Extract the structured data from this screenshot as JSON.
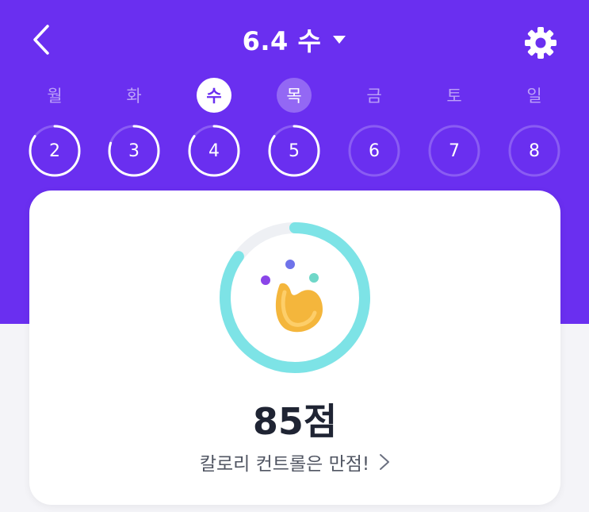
{
  "header": {
    "title": "6.4 수",
    "colors": {
      "background": "#6a2ff0",
      "text": "#ffffff"
    },
    "icons": {
      "back": "chevron-left-icon",
      "dropdown": "caret-down-icon",
      "settings": "gear-icon"
    }
  },
  "week": {
    "days": [
      {
        "weekday": "월",
        "date": "2",
        "progress": 0.85,
        "state": "past"
      },
      {
        "weekday": "화",
        "date": "3",
        "progress": 0.8,
        "state": "past"
      },
      {
        "weekday": "수",
        "date": "4",
        "progress": 0.85,
        "state": "selected"
      },
      {
        "weekday": "목",
        "date": "5",
        "progress": 0.85,
        "state": "today"
      },
      {
        "weekday": "금",
        "date": "6",
        "progress": 0,
        "state": "future"
      },
      {
        "weekday": "토",
        "date": "7",
        "progress": 0,
        "state": "future"
      },
      {
        "weekday": "일",
        "date": "8",
        "progress": 0,
        "state": "future"
      }
    ]
  },
  "summary": {
    "score_text": "85점",
    "score_progress": 0.85,
    "message": "칼로리 컨트롤은 만점!",
    "ring_color": "#7de3e6",
    "mascot_icon": "mascot-character-icon"
  }
}
